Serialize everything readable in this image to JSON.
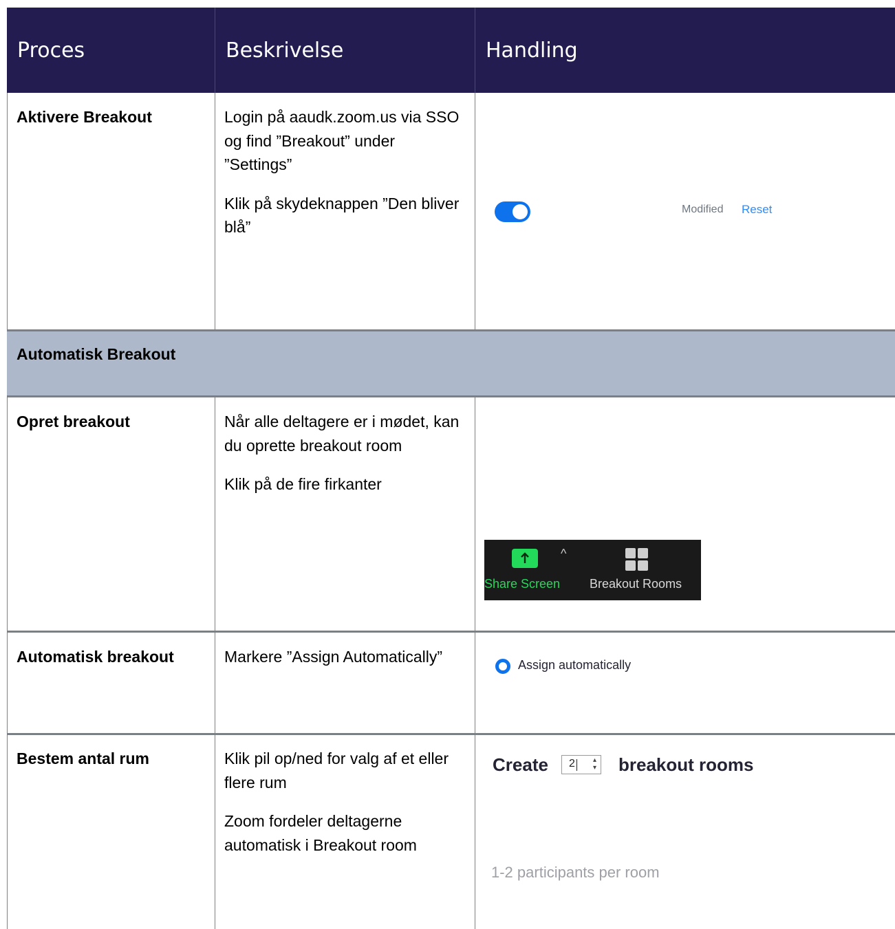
{
  "header": {
    "col_proces": "Proces",
    "col_beskrivelse": "Beskrivelse",
    "col_handling": "Handling"
  },
  "rows": [
    {
      "proces": "Aktivere Breakout",
      "desc": [
        "Login på aaudk.zoom.us via SSO og find ”Breakout” under ”Settings”",
        "Klik på skydeknappen ”Den bliver blå”"
      ]
    },
    {
      "proces": "Opret breakout",
      "desc": [
        "Når alle deltagere er i mødet, kan du oprette breakout room",
        "Klik på de fire firkanter"
      ]
    },
    {
      "proces": "Automatisk breakout",
      "desc": [
        "Markere ”Assign Automatically”"
      ]
    },
    {
      "proces": "Bestem antal rum",
      "desc": [
        "Klik pil op/ned for valg af et eller flere rum",
        "Zoom fordeler deltagerne automatisk i Breakout room"
      ]
    }
  ],
  "section": {
    "title": "Automatisk Breakout"
  },
  "settings": {
    "toggle_on": true,
    "modified_label": "Modified",
    "reset_label": "Reset"
  },
  "toolbar": {
    "share_label": "Share Screen",
    "caret": "^",
    "rooms_label": "Breakout Rooms"
  },
  "assign": {
    "label": "Assign automatically",
    "selected": true
  },
  "create": {
    "prefix": "Create",
    "count": "2",
    "suffix": "breakout rooms",
    "participants": "1-2 participants per room"
  },
  "colors": {
    "header_bg": "#221c50",
    "section_bg": "#adb9ca",
    "zoom_blue": "#0e72ed",
    "share_green": "#23d959"
  }
}
